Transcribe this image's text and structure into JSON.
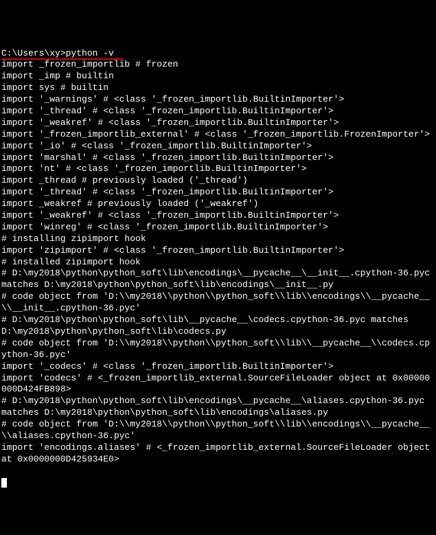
{
  "prompt": "C:\\Users\\xy>",
  "command": "python -v",
  "lines": [
    "import _frozen_importlib # frozen",
    "import _imp # builtin",
    "import sys # builtin",
    "import '_warnings' # <class '_frozen_importlib.BuiltinImporter'>",
    "import '_thread' # <class '_frozen_importlib.BuiltinImporter'>",
    "import '_weakref' # <class '_frozen_importlib.BuiltinImporter'>",
    "import '_frozen_importlib_external' # <class '_frozen_importlib.FrozenImporter'>",
    "",
    "import '_io' # <class '_frozen_importlib.BuiltinImporter'>",
    "import 'marshal' # <class '_frozen_importlib.BuiltinImporter'>",
    "import 'nt' # <class '_frozen_importlib.BuiltinImporter'>",
    "import _thread # previously loaded ('_thread')",
    "import '_thread' # <class '_frozen_importlib.BuiltinImporter'>",
    "import _weakref # previously loaded ('_weakref')",
    "import '_weakref' # <class '_frozen_importlib.BuiltinImporter'>",
    "import 'winreg' # <class '_frozen_importlib.BuiltinImporter'>",
    "# installing zipimport hook",
    "import 'zipimport' # <class '_frozen_importlib.BuiltinImporter'>",
    "# installed zipimport hook",
    "# D:\\my2018\\python\\python_soft\\lib\\encodings\\__pycache__\\__init__.cpython-36.pyc matches D:\\my2018\\python\\python_soft\\lib\\encodings\\__init__.py",
    "# code object from 'D:\\\\my2018\\\\python\\\\python_soft\\\\lib\\\\encodings\\\\__pycache__\\\\__init__.cpython-36.pyc'",
    "# D:\\my2018\\python\\python_soft\\lib\\__pycache__\\codecs.cpython-36.pyc matches D:\\my2018\\python\\python_soft\\lib\\codecs.py",
    "# code object from 'D:\\\\my2018\\\\python\\\\python_soft\\\\lib\\\\__pycache__\\\\codecs.cpython-36.pyc'",
    "import '_codecs' # <class '_frozen_importlib.BuiltinImporter'>",
    "import 'codecs' # <_frozen_importlib_external.SourceFileLoader object at 0x00000000D424FB898>",
    "# D:\\my2018\\python\\python_soft\\lib\\encodings\\__pycache__\\aliases.cpython-36.pyc matches D:\\my2018\\python\\python_soft\\lib\\encodings\\aliases.py",
    "# code object from 'D:\\\\my2018\\\\python\\\\python_soft\\\\lib\\\\encodings\\\\__pycache__\\\\aliases.cpython-36.pyc'",
    "import 'encodings.aliases' # <_frozen_importlib_external.SourceFileLoader object at 0x0000000D425934E0>"
  ]
}
